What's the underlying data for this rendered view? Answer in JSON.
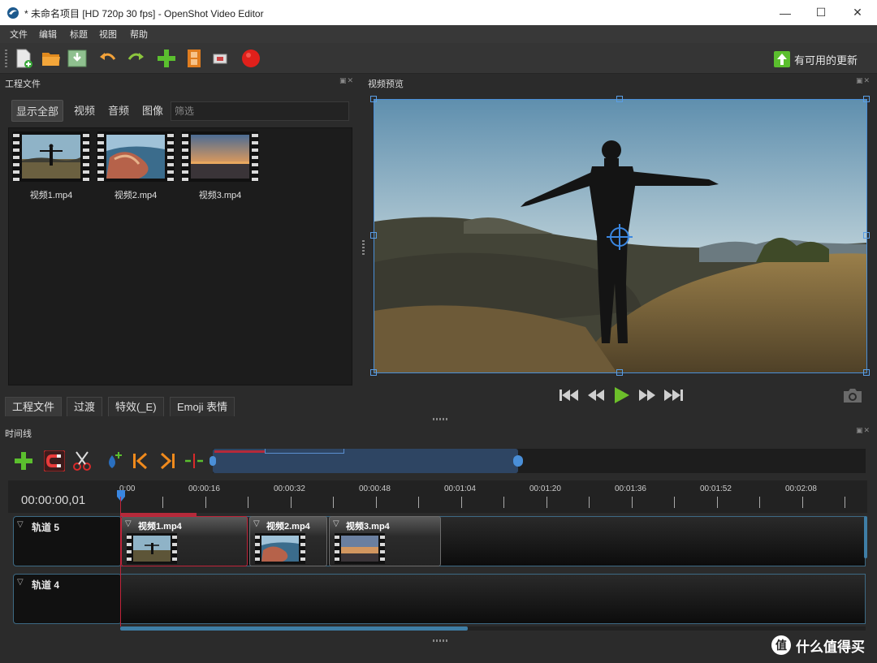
{
  "window": {
    "title": "* 未命名项目 [HD 720p 30 fps] - OpenShot Video Editor",
    "minimize": "—",
    "maximize": "☐",
    "close": "✕"
  },
  "menu": [
    "文件",
    "编辑",
    "标题",
    "视图",
    "帮助"
  ],
  "toolbar": {
    "buttons": [
      "new-project-icon",
      "open-project-icon",
      "save-project-icon",
      "undo-icon",
      "redo-icon",
      "import-files-icon",
      "choose-profile-icon",
      "fullscreen-icon",
      "export-video-icon"
    ],
    "update_label": "有可用的更新"
  },
  "project_files": {
    "title": "工程文件",
    "filter_tabs": [
      "显示全部",
      "视频",
      "音频",
      "图像"
    ],
    "search_placeholder": "筛选",
    "files": [
      "视频1.mp4",
      "视频2.mp4",
      "视频3.mp4"
    ]
  },
  "bottom_tabs": [
    "工程文件",
    "过渡",
    "特效(_E)",
    "Emoji 表情"
  ],
  "preview": {
    "title": "视频预览"
  },
  "timeline": {
    "title": "时间线",
    "timecode": "00:00:00,01",
    "ticks": [
      "0:00",
      "00:00:16",
      "00:00:32",
      "00:00:48",
      "00:01:04",
      "00:01:20",
      "00:01:36",
      "00:01:52",
      "00:02:08"
    ],
    "tracks": [
      {
        "name": "轨道 5",
        "clips": [
          "视频1.mp4",
          "视频2.mp4",
          "视频3.mp4"
        ]
      },
      {
        "name": "轨道 4",
        "clips": []
      }
    ]
  },
  "watermark": {
    "badge": "值",
    "text": "什么值得买"
  },
  "colors": {
    "accent": "#3f7ea6",
    "playhead": "#c0243a",
    "selection": "#4a8fd8"
  }
}
